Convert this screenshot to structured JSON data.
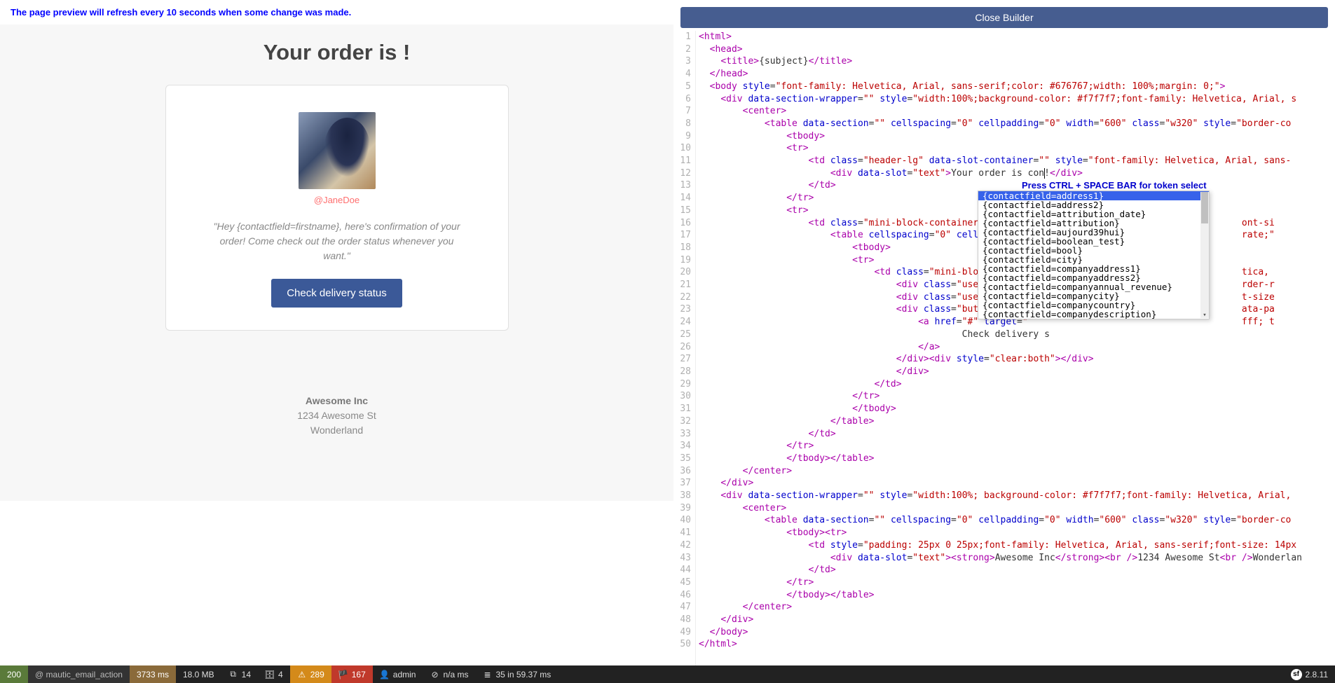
{
  "preview": {
    "refresh_notice": "The page preview will refresh every 10 seconds when some change was made.",
    "heading": "Your order is !",
    "handle": "@JaneDoe",
    "message": "\"Hey {contactfield=firstname}, here's confirmation of your order! Come check out the order status whenever you want.\"",
    "button_label": "Check delivery status",
    "company": "Awesome Inc",
    "address1": "1234 Awesome St",
    "address2": "Wonderland"
  },
  "builder": {
    "close_label": "Close Builder",
    "hint": "Press CTRL + SPACE BAR for token select"
  },
  "autocomplete": {
    "items": [
      "{contactfield=address1}",
      "{contactfield=address2}",
      "{contactfield=attribution_date}",
      "{contactfield=attribution}",
      "{contactfield=aujourd39hui}",
      "{contactfield=boolean_test}",
      "{contactfield=bool}",
      "{contactfield=city}",
      "{contactfield=companyaddress1}",
      "{contactfield=companyaddress2}",
      "{contactfield=companyannual_revenue}",
      "{contactfield=companycity}",
      "{contactfield=companycountry}",
      "{contactfield=companydescription}"
    ]
  },
  "code_text": {
    "l12_text": "Your order is con",
    "l25_text": "                                                Check delivery s",
    "l43_text1": "Awesome Inc",
    "l43_text2": "1234 Awesome St",
    "l43_text3": "Wonderlan"
  },
  "status": {
    "code": "200",
    "route": "@ mautic_email_action",
    "time": "3733 ms",
    "mem": "18.0 MB",
    "forms": "14",
    "db": "4",
    "warn": "289",
    "err": "167",
    "user": "admin",
    "na": "n/a ms",
    "perf": "35 in 59.37 ms",
    "sf": "2.8.11"
  }
}
